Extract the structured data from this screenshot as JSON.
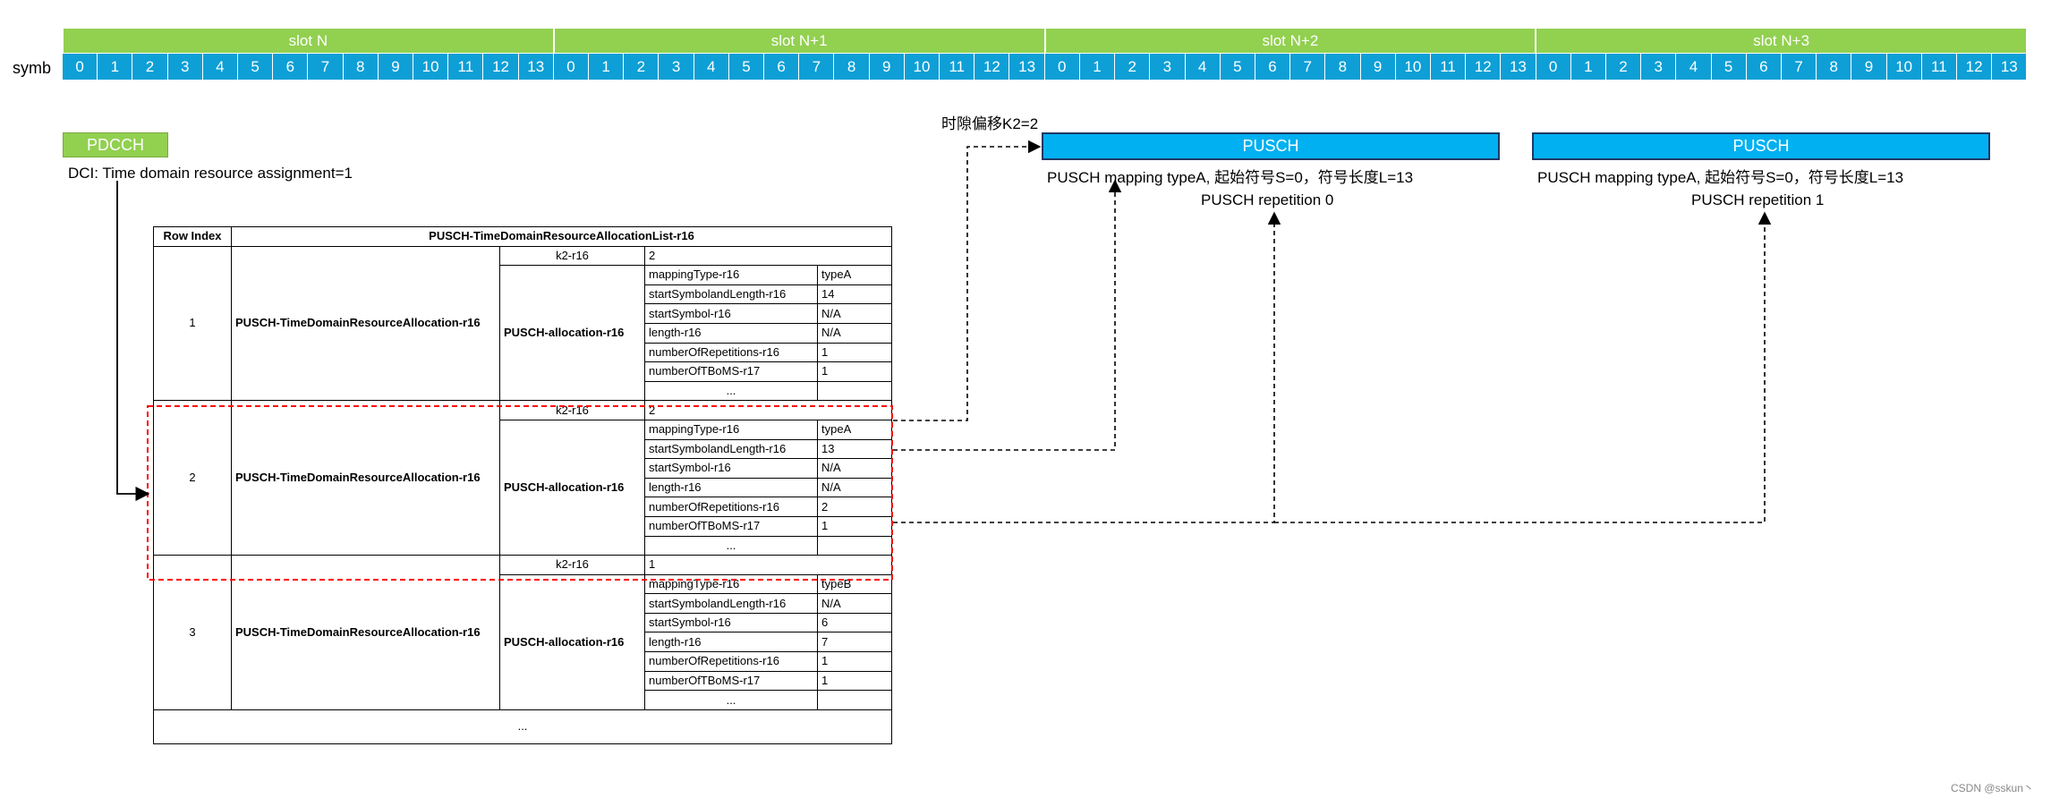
{
  "header": {
    "slots": [
      {
        "label": "slot N"
      },
      {
        "label": "slot N+1"
      },
      {
        "label": "slot N+2"
      },
      {
        "label": "slot N+3"
      }
    ],
    "symb_label": "symb",
    "symbols": [
      "0",
      "1",
      "2",
      "3",
      "4",
      "5",
      "6",
      "7",
      "8",
      "9",
      "10",
      "11",
      "12",
      "13",
      "0",
      "1",
      "2",
      "3",
      "4",
      "5",
      "6",
      "7",
      "8",
      "9",
      "10",
      "11",
      "12",
      "13",
      "0",
      "1",
      "2",
      "3",
      "4",
      "5",
      "6",
      "7",
      "8",
      "9",
      "10",
      "11",
      "12",
      "13",
      "0",
      "1",
      "2",
      "3",
      "4",
      "5",
      "6",
      "7",
      "8",
      "9",
      "10",
      "11",
      "12",
      "13"
    ]
  },
  "pdcch": {
    "label": "PDCCH",
    "dci_text": "DCI: Time domain resource assignment=1"
  },
  "offset_label": "时隙偏移K2=2",
  "pusch": [
    {
      "label": "PUSCH",
      "mapping": "PUSCH mapping typeA, 起始符号S=0，符号长度L=13",
      "repetition": "PUSCH repetition 0"
    },
    {
      "label": "PUSCH",
      "mapping": "PUSCH mapping typeA, 起始符号S=0，符号长度L=13",
      "repetition": "PUSCH repetition 1"
    }
  ],
  "table": {
    "row_index_header": "Row Index",
    "list_header": "PUSCH-TimeDomainResourceAllocationList-r16",
    "rows": [
      {
        "index": "1",
        "name": "PUSCH-TimeDomainResourceAllocation-r16",
        "k2_label": "k2-r16",
        "k2_value": "2",
        "alloc_label": "PUSCH-allocation-r16",
        "params": [
          {
            "k": "mappingType-r16",
            "v": "typeA"
          },
          {
            "k": "startSymbolandLength-r16",
            "v": "14"
          },
          {
            "k": "startSymbol-r16",
            "v": "N/A"
          },
          {
            "k": "length-r16",
            "v": "N/A"
          },
          {
            "k": "numberOfRepetitions-r16",
            "v": "1"
          },
          {
            "k": "numberOfTBoMS-r17",
            "v": "1"
          },
          {
            "k": "...",
            "v": ""
          }
        ]
      },
      {
        "index": "2",
        "name": "PUSCH-TimeDomainResourceAllocation-r16",
        "k2_label": "k2-r16",
        "k2_value": "2",
        "alloc_label": "PUSCH-allocation-r16",
        "params": [
          {
            "k": "mappingType-r16",
            "v": "typeA"
          },
          {
            "k": "startSymbolandLength-r16",
            "v": "13"
          },
          {
            "k": "startSymbol-r16",
            "v": "N/A"
          },
          {
            "k": "length-r16",
            "v": "N/A"
          },
          {
            "k": "numberOfRepetitions-r16",
            "v": "2"
          },
          {
            "k": "numberOfTBoMS-r17",
            "v": "1"
          },
          {
            "k": "...",
            "v": ""
          }
        ]
      },
      {
        "index": "3",
        "name": "PUSCH-TimeDomainResourceAllocation-r16",
        "k2_label": "k2-r16",
        "k2_value": "1",
        "alloc_label": "PUSCH-allocation-r16",
        "params": [
          {
            "k": "mappingType-r16",
            "v": "typeB"
          },
          {
            "k": "startSymbolandLength-r16",
            "v": "N/A"
          },
          {
            "k": "startSymbol-r16",
            "v": "6"
          },
          {
            "k": "length-r16",
            "v": "7"
          },
          {
            "k": "numberOfRepetitions-r16",
            "v": "1"
          },
          {
            "k": "numberOfTBoMS-r17",
            "v": "1"
          },
          {
            "k": "...",
            "v": ""
          }
        ]
      }
    ],
    "ellipsis": "..."
  },
  "watermark": "CSDN @sskun丶",
  "colors": {
    "slot": "#92d050",
    "symbol": "#0d9fd6",
    "pusch": "#00b0f0",
    "highlight": "#ff0000"
  }
}
